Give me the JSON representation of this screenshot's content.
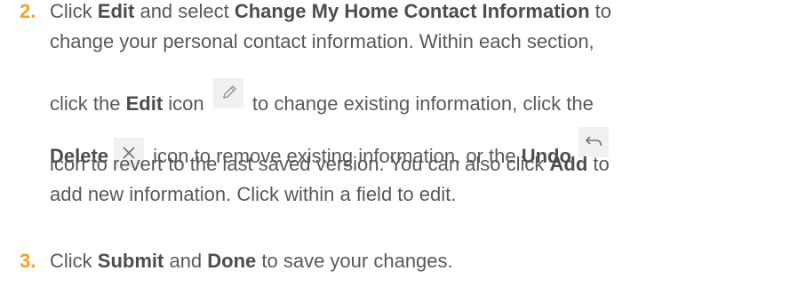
{
  "step2": {
    "number": "2.",
    "l1_a": "Click ",
    "l1_b": "Edit",
    "l1_c": " and select ",
    "l1_d": "Change My Home Contact Information",
    "l1_e": " to",
    "l2": "change your personal contact information. Within each section,",
    "l3_a": "click the ",
    "l3_b": "Edit",
    "l3_c": " icon ",
    "l3_d": " to change existing information, click the",
    "l4_a": "Delete",
    "l4_b": " icon to remove existing information, or the ",
    "l4_c": "Undo",
    "l5": "icon to revert to the last saved version. You can also click ",
    "l5_b": "Add",
    "l5_c": " to",
    "l6": "add new information. Click within a field to edit."
  },
  "step3": {
    "number": "3.",
    "a": "Click ",
    "b": "Submit",
    "c": " and ",
    "d": "Done",
    "e": " to save your changes."
  },
  "icons": {
    "edit": "pencil-icon",
    "delete": "close-icon",
    "undo": "undo-icon"
  }
}
